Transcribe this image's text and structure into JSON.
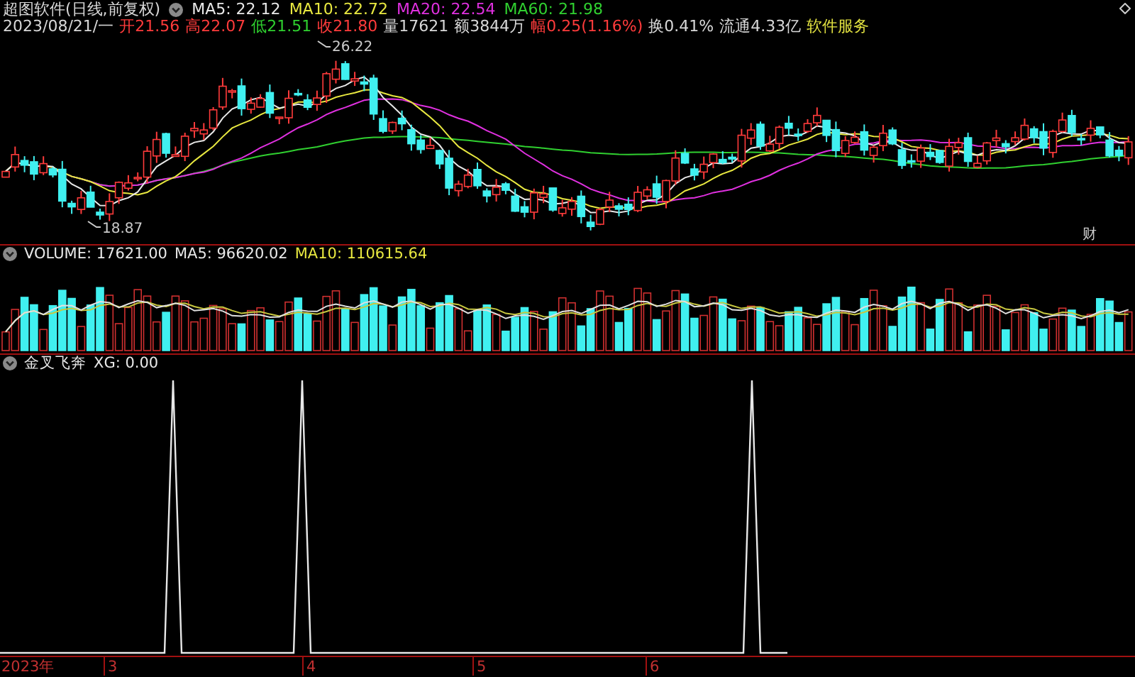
{
  "header": {
    "title": "超图软件(日线,前复权)",
    "indicators": [
      {
        "label": "MA5: 22.12",
        "color": "#e8e8e8"
      },
      {
        "label": "MA10: 22.72",
        "color": "#e8e840"
      },
      {
        "label": "MA20: 22.54",
        "color": "#e030e0"
      },
      {
        "label": "MA60: 21.98",
        "color": "#30d030"
      }
    ]
  },
  "quote": [
    {
      "text": "2023/08/21/一",
      "kind": "plain"
    },
    {
      "text": "开21.56",
      "kind": "up"
    },
    {
      "text": "高22.07",
      "kind": "up"
    },
    {
      "text": "低21.51",
      "kind": "down"
    },
    {
      "text": "收21.80",
      "kind": "up"
    },
    {
      "text": "量17621",
      "kind": "plain"
    },
    {
      "text": "额3844万",
      "kind": "plain"
    },
    {
      "text": "幅0.25(1.16%)",
      "kind": "up"
    },
    {
      "text": "换0.41%",
      "kind": "plain"
    },
    {
      "text": "流通4.33亿",
      "kind": "plain"
    },
    {
      "text": "软件服务",
      "kind": "sector"
    }
  ],
  "price_chart": {
    "high_label": "26.22",
    "low_label": "18.87",
    "marker": "财"
  },
  "volume": {
    "indicators": [
      {
        "label": "VOLUME: 17621.00",
        "color": "#e8e8e8"
      },
      {
        "label": "MA5: 96620.02",
        "color": "#e8e8e8"
      },
      {
        "label": "MA10: 110615.64",
        "color": "#e8e840"
      }
    ]
  },
  "signal": {
    "indicators": [
      {
        "label": "金叉飞奔",
        "color": "#e8e8e8"
      },
      {
        "label": "XG: 0.00",
        "color": "#e8e8e8"
      }
    ]
  },
  "time_axis": [
    "2023年",
    "3",
    "4",
    "5",
    "6"
  ]
}
